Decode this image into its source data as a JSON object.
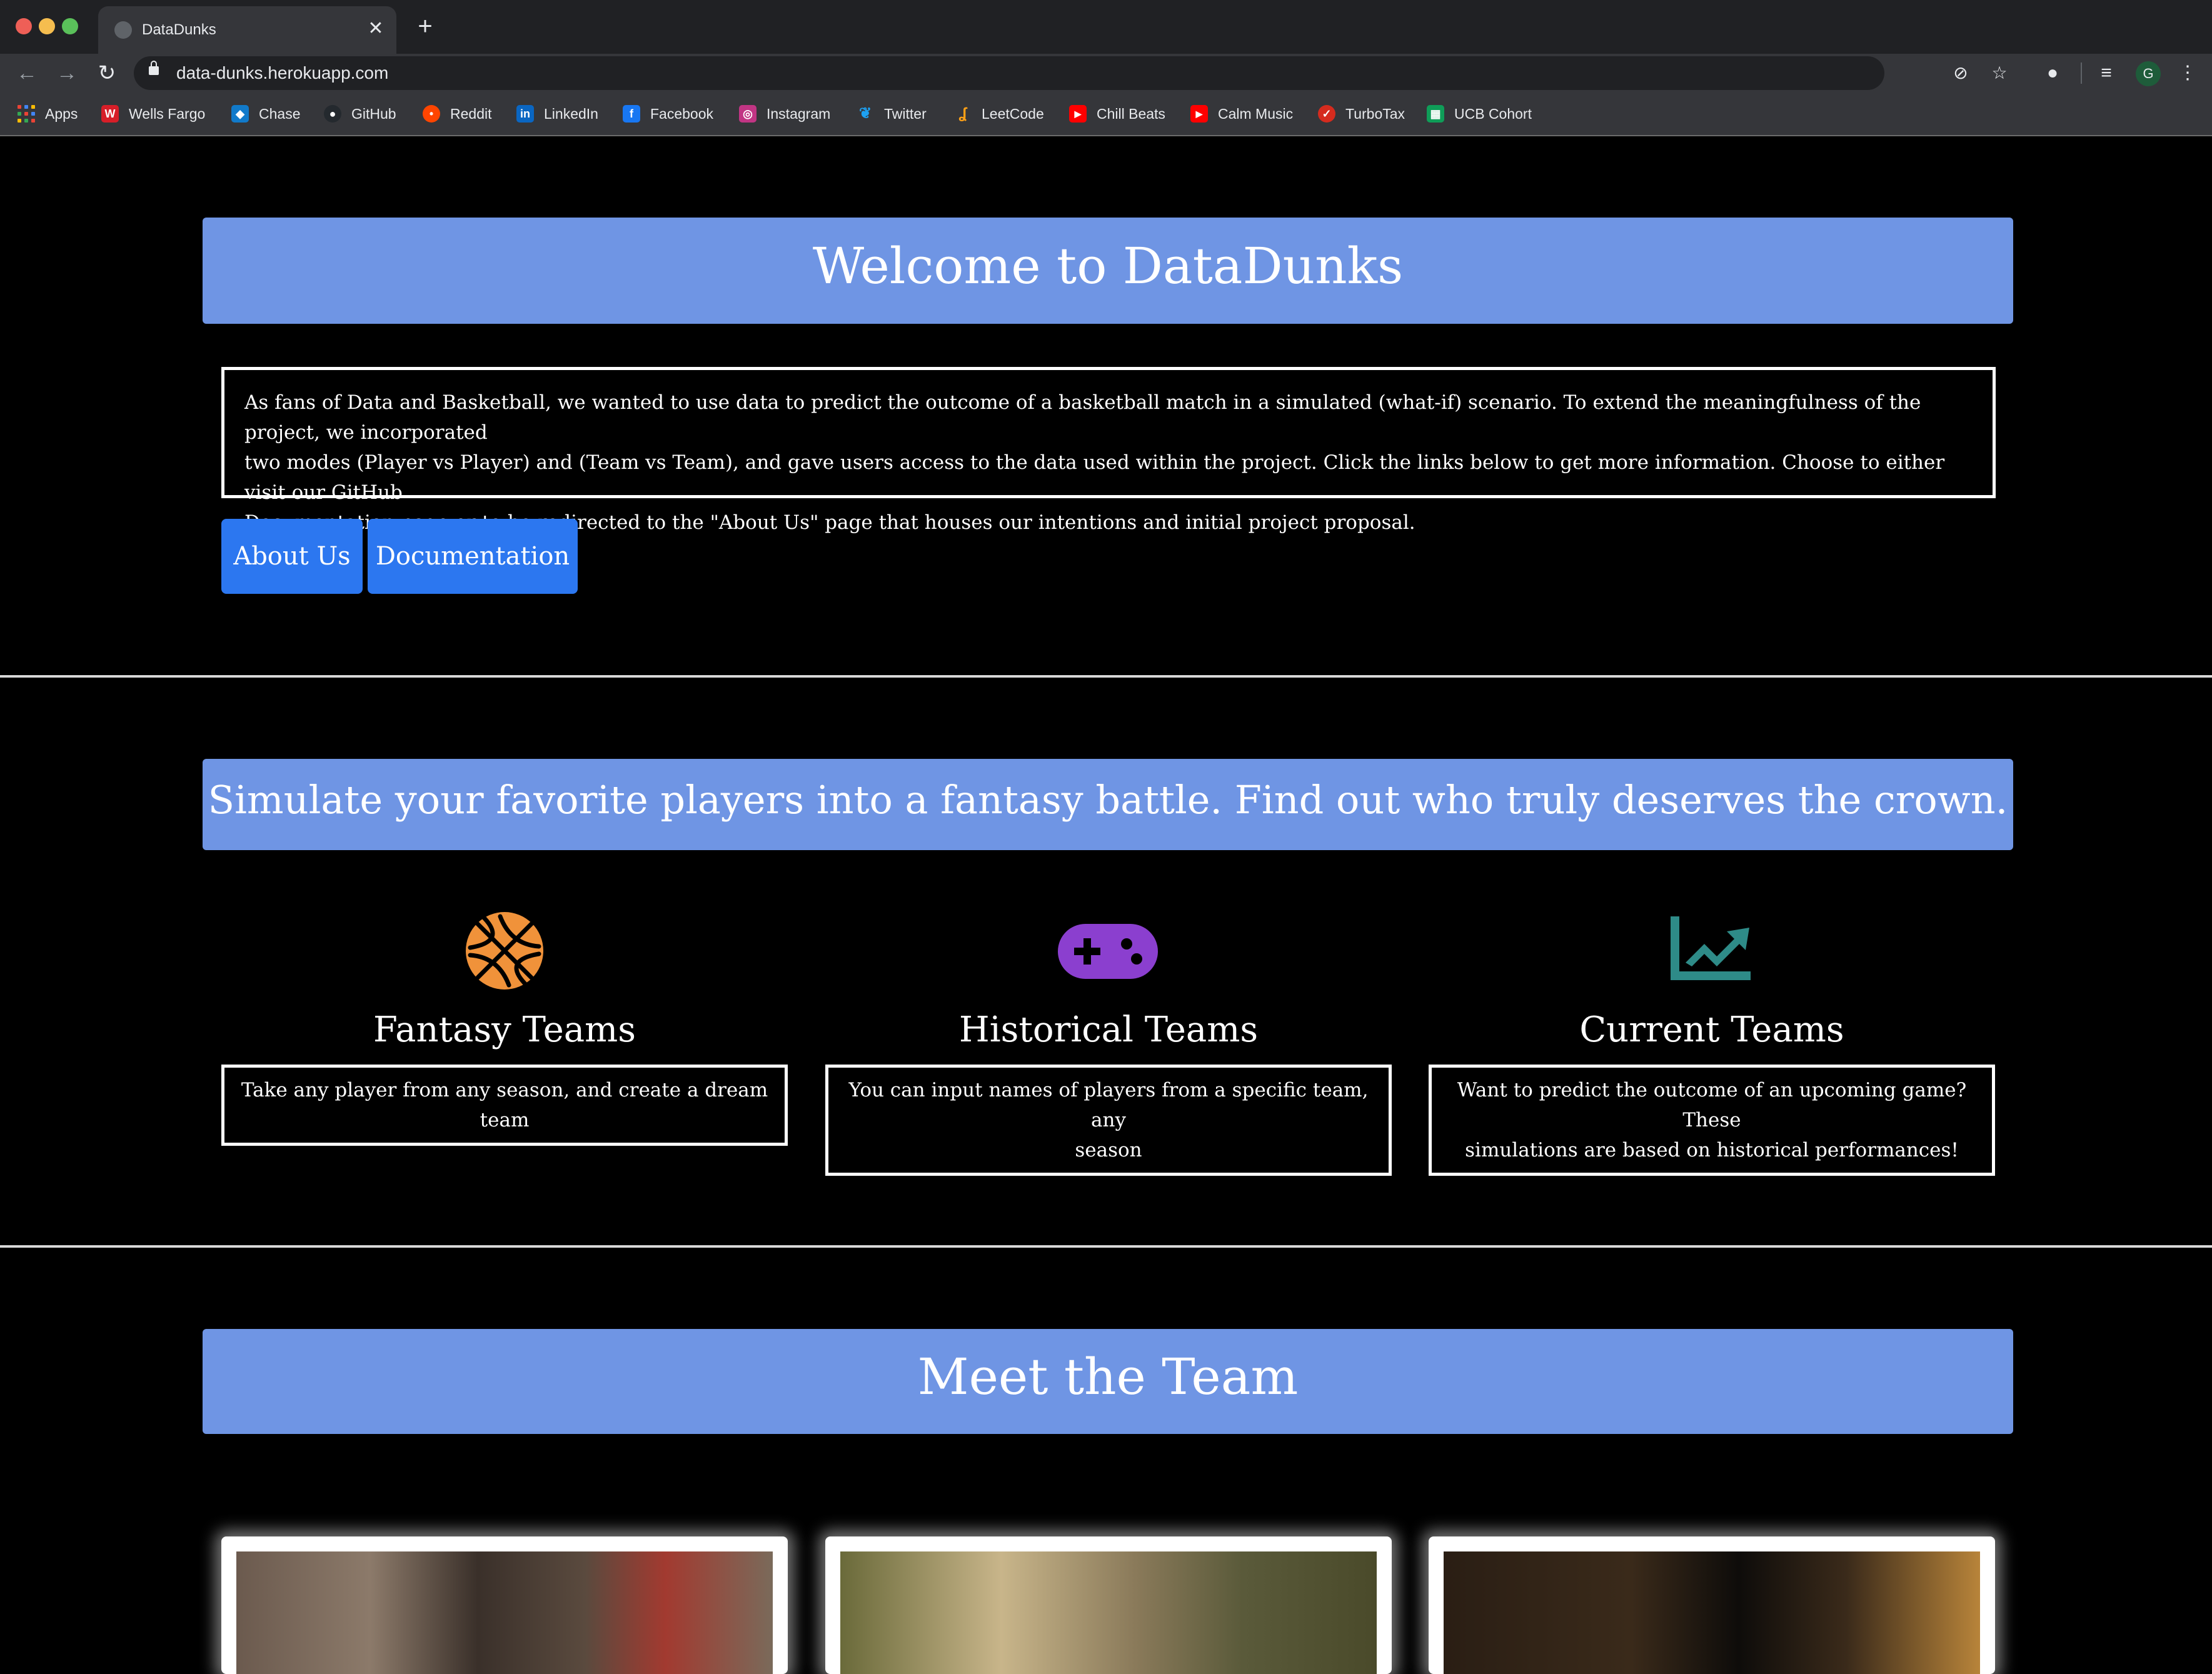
{
  "browser": {
    "tab_title": "DataDunks",
    "tab_close_glyph": "✕",
    "new_tab_glyph": "+",
    "url": "data-dunks.herokuapp.com",
    "profile_initial": "G",
    "icons": [
      "back-arrow-icon",
      "forward-arrow-icon",
      "reload-icon",
      "lock-icon",
      "blocked-popup-icon",
      "star-icon",
      "extension-icon",
      "media-queue-icon",
      "menu-kebab-icon"
    ]
  },
  "bookmarks": [
    {
      "label": "Apps",
      "icon": "apps-grid-icon",
      "color": "#4285f4"
    },
    {
      "label": "Wells Fargo",
      "icon": "wells-fargo-icon",
      "color": "#d71e28"
    },
    {
      "label": "Chase",
      "icon": "chase-icon",
      "color": "#117aca"
    },
    {
      "label": "GitHub",
      "icon": "github-icon",
      "color": "#24292e"
    },
    {
      "label": "Reddit",
      "icon": "reddit-icon",
      "color": "#ff4500"
    },
    {
      "label": "LinkedIn",
      "icon": "linkedin-icon",
      "color": "#0a66c2"
    },
    {
      "label": "Facebook",
      "icon": "facebook-icon",
      "color": "#1877f2"
    },
    {
      "label": "Instagram",
      "icon": "instagram-icon",
      "color": "#c13584"
    },
    {
      "label": "Twitter",
      "icon": "twitter-icon",
      "color": "#1da1f2"
    },
    {
      "label": "LeetCode",
      "icon": "leetcode-icon",
      "color": "#ffa116"
    },
    {
      "label": "Chill Beats",
      "icon": "youtube-icon",
      "color": "#ff0000"
    },
    {
      "label": "Calm Music",
      "icon": "youtube-icon",
      "color": "#ff0000"
    },
    {
      "label": "TurboTax",
      "icon": "turbotax-icon",
      "color": "#d52b1e"
    },
    {
      "label": "UCB Cohort",
      "icon": "sheets-icon",
      "color": "#0f9d58"
    }
  ],
  "hero": {
    "title": "Welcome to DataDunks",
    "intro_lines": [
      "As fans of Data and Basketball, we wanted to use data to predict the outcome of a basketball match in a simulated (what-if) scenario. To extend the meaningfulness of the project, we incorporated",
      "two modes (Player vs Player) and (Team vs Team), and gave users access to the data used within the project. Click the links below to get more information. Choose to either visit our GitHub",
      "Documentation page or to be redirected to the \"About Us\" page that houses our intentions and initial project proposal."
    ],
    "about_button": "About Us",
    "docs_button": "Documentation",
    "banner_color": "#6f95e4",
    "button_color": "#2c77f0"
  },
  "simulate": {
    "banner": "Simulate your favorite players into a fantasy battle. Find out who truly deserves the crown.",
    "features": [
      {
        "title": "Fantasy Teams",
        "lines": [
          "Take any player from any season, and create a dream team"
        ],
        "icon": "basketball-icon",
        "color": "#f0923a"
      },
      {
        "title": "Historical Teams",
        "lines": [
          "You can input names of players from a specific team, any",
          "season"
        ],
        "icon": "gamepad-icon",
        "color": "#8b3fcf"
      },
      {
        "title": "Current Teams",
        "lines": [
          "Want to predict the outcome of an upcoming game? These",
          "simulations are based on historical performances!"
        ],
        "icon": "chart-line-icon",
        "color": "#2e8b88"
      }
    ]
  },
  "team": {
    "banner": "Meet the Team"
  }
}
